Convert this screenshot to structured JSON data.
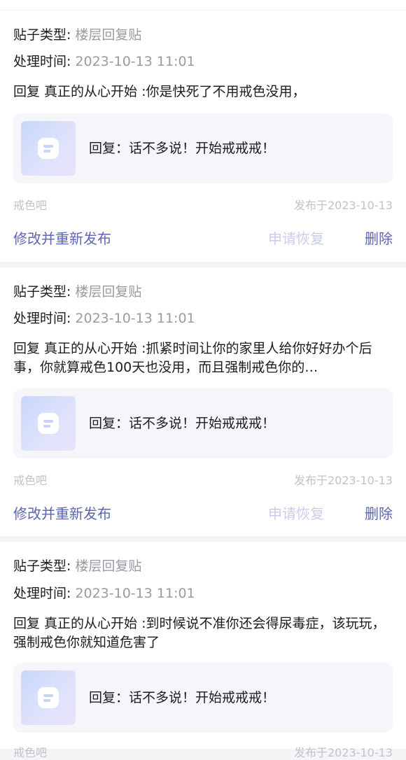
{
  "posts": [
    {
      "type_label": "贴子类型:",
      "type_value": "楼层回复贴",
      "time_label": "处理时间:",
      "time_value": "2023-10-13 11:01",
      "reply_text": "回复 真正的从心开始 :你是快死了不用戒色没用，",
      "quote_text": "回复：话不多说！开始戒戒戒！",
      "forum": "戒色吧",
      "date": "发布于2023-10-13",
      "edit_label": "修改并重新发布",
      "restore_label": "申请恢复",
      "delete_label": "删除"
    },
    {
      "type_label": "贴子类型:",
      "type_value": "楼层回复贴",
      "time_label": "处理时间:",
      "time_value": "2023-10-13 11:01",
      "reply_text": "回复 真正的从心开始 :抓紧时间让你的家里人给你好好办个后事，你就算戒色100天也没用，而且强制戒色你的…",
      "quote_text": "回复：话不多说！开始戒戒戒！",
      "forum": "戒色吧",
      "date": "发布于2023-10-13",
      "edit_label": "修改并重新发布",
      "restore_label": "申请恢复",
      "delete_label": "删除"
    },
    {
      "type_label": "贴子类型:",
      "type_value": "楼层回复贴",
      "time_label": "处理时间:",
      "time_value": "2023-10-13 11:01",
      "reply_text": "回复 真正的从心开始 :到时候说不准你还会得尿毒症，该玩玩，强制戒色你就知道危害了",
      "quote_text": "回复：话不多说！开始戒戒戒！",
      "forum": "戒色吧",
      "date": "发布于2023-10-13"
    }
  ],
  "colors": {
    "accent": "#5c66b2",
    "accent_disabled": "#c9cdeb",
    "muted": "#9a9aa2",
    "background": "#f4f5f7"
  },
  "icons": {
    "quote_thumbnail": "app-logo-icon"
  }
}
